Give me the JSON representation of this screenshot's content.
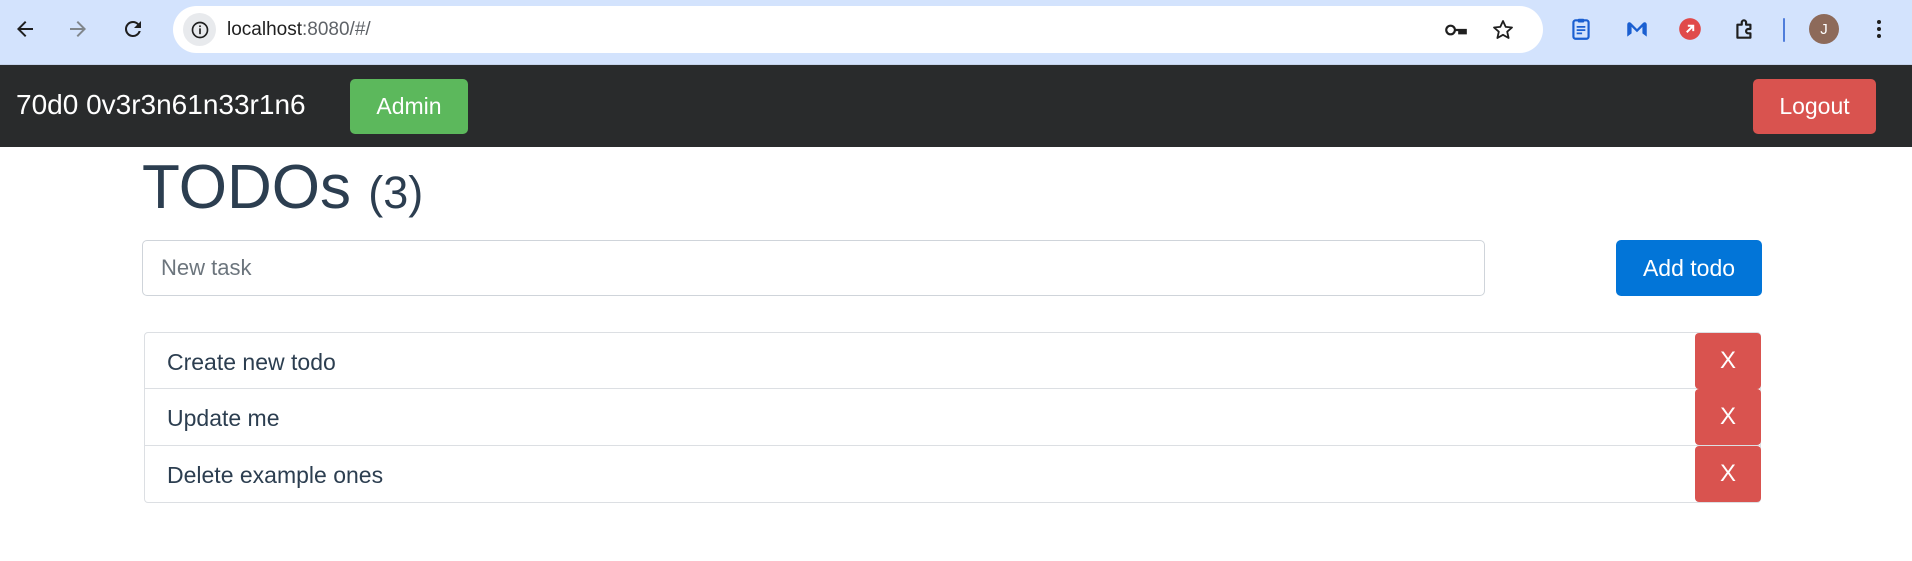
{
  "browser": {
    "url_host": "localhost",
    "url_path": ":8080/#/",
    "avatar_initial": "J",
    "icons": {
      "back": "arrow-left-icon",
      "forward": "arrow-right-icon",
      "reload": "reload-icon",
      "site_info": "info-icon",
      "password": "key-icon",
      "bookmark": "star-icon",
      "ext1": "clipboard-icon",
      "ext2": "malwarebytes-icon",
      "ext3": "red-extension-icon",
      "extensions": "puzzle-icon",
      "menu": "kebab-menu-icon"
    },
    "colors": {
      "chrome_bg": "#d3e3fd",
      "ext_blue": "#1a5fd1",
      "ext_red": "#e04a4a"
    }
  },
  "navbar": {
    "brand": "70d0 0v3r3n61n33r1n6",
    "admin_label": "Admin",
    "logout_label": "Logout",
    "colors": {
      "bg": "#292b2c",
      "admin": "#5cb85c",
      "logout": "#d9534f"
    }
  },
  "main": {
    "title": "TODOs",
    "count": "(3)",
    "input_placeholder": "New task",
    "input_value": "",
    "add_label": "Add todo",
    "todos": [
      {
        "text": "Create new todo",
        "delete_label": "X"
      },
      {
        "text": "Update me",
        "delete_label": "X"
      },
      {
        "text": "Delete example ones",
        "delete_label": "X"
      }
    ],
    "colors": {
      "add": "#0275d8",
      "delete": "#d9534f",
      "text": "#2c3e50"
    }
  }
}
